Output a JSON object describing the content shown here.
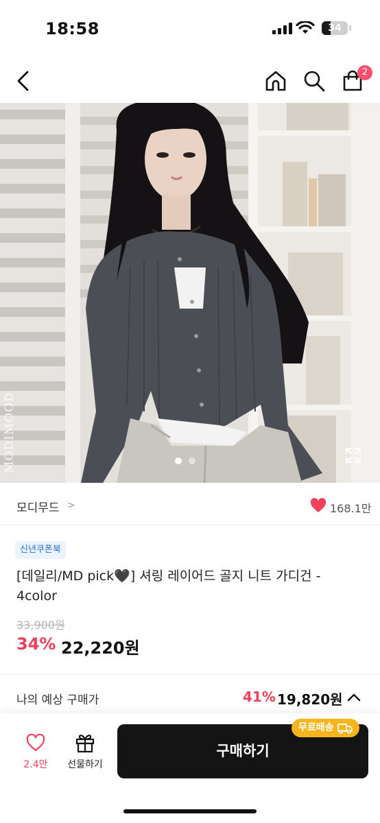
{
  "status_bar": {
    "time": "18:58",
    "battery_level": "34",
    "icons": [
      "signal-icon",
      "wifi-icon",
      "battery-icon"
    ]
  },
  "nav": {
    "icons": [
      "back-arrow-icon",
      "home-icon",
      "search-icon",
      "shopping-bag-icon"
    ],
    "cart_count": "2"
  },
  "hero": {
    "watermark": "MODIMOOD",
    "carousel_total": 2,
    "carousel_active": 1,
    "icons": [
      "expand-icon"
    ]
  },
  "brand": {
    "name": "모디무드",
    "chevron": ">",
    "likes": "168.1만",
    "icons": [
      "heart-filled-icon"
    ]
  },
  "product": {
    "coupon_badge": "신년쿠폰북",
    "title": "[데일리/MD pick🖤] 셔링 레이어드 골지 니트 가디건 - 4color",
    "original_price": "33,900원",
    "discount_rate": "34%",
    "sale_price": "22,220원"
  },
  "expected_price": {
    "label": "나의 예상 구매가",
    "discount_rate": "41%",
    "price": "19,820원",
    "icons": [
      "chevron-up-icon"
    ]
  },
  "bottom_bar": {
    "wish_count": "2.4만",
    "gift_label": "선물하기",
    "buy_label": "구매하기",
    "free_shipping_label": "무료배송",
    "icons": [
      "heart-outline-icon",
      "gift-icon",
      "truck-icon"
    ]
  },
  "colors": {
    "accent_red": "#f0405a",
    "badge_pink": "#ff4f6e",
    "coupon_blue": "#2d6fd6",
    "coupon_bg": "#eaf3ff",
    "ship_yellow": "#f6b51c",
    "button_black": "#141414"
  }
}
